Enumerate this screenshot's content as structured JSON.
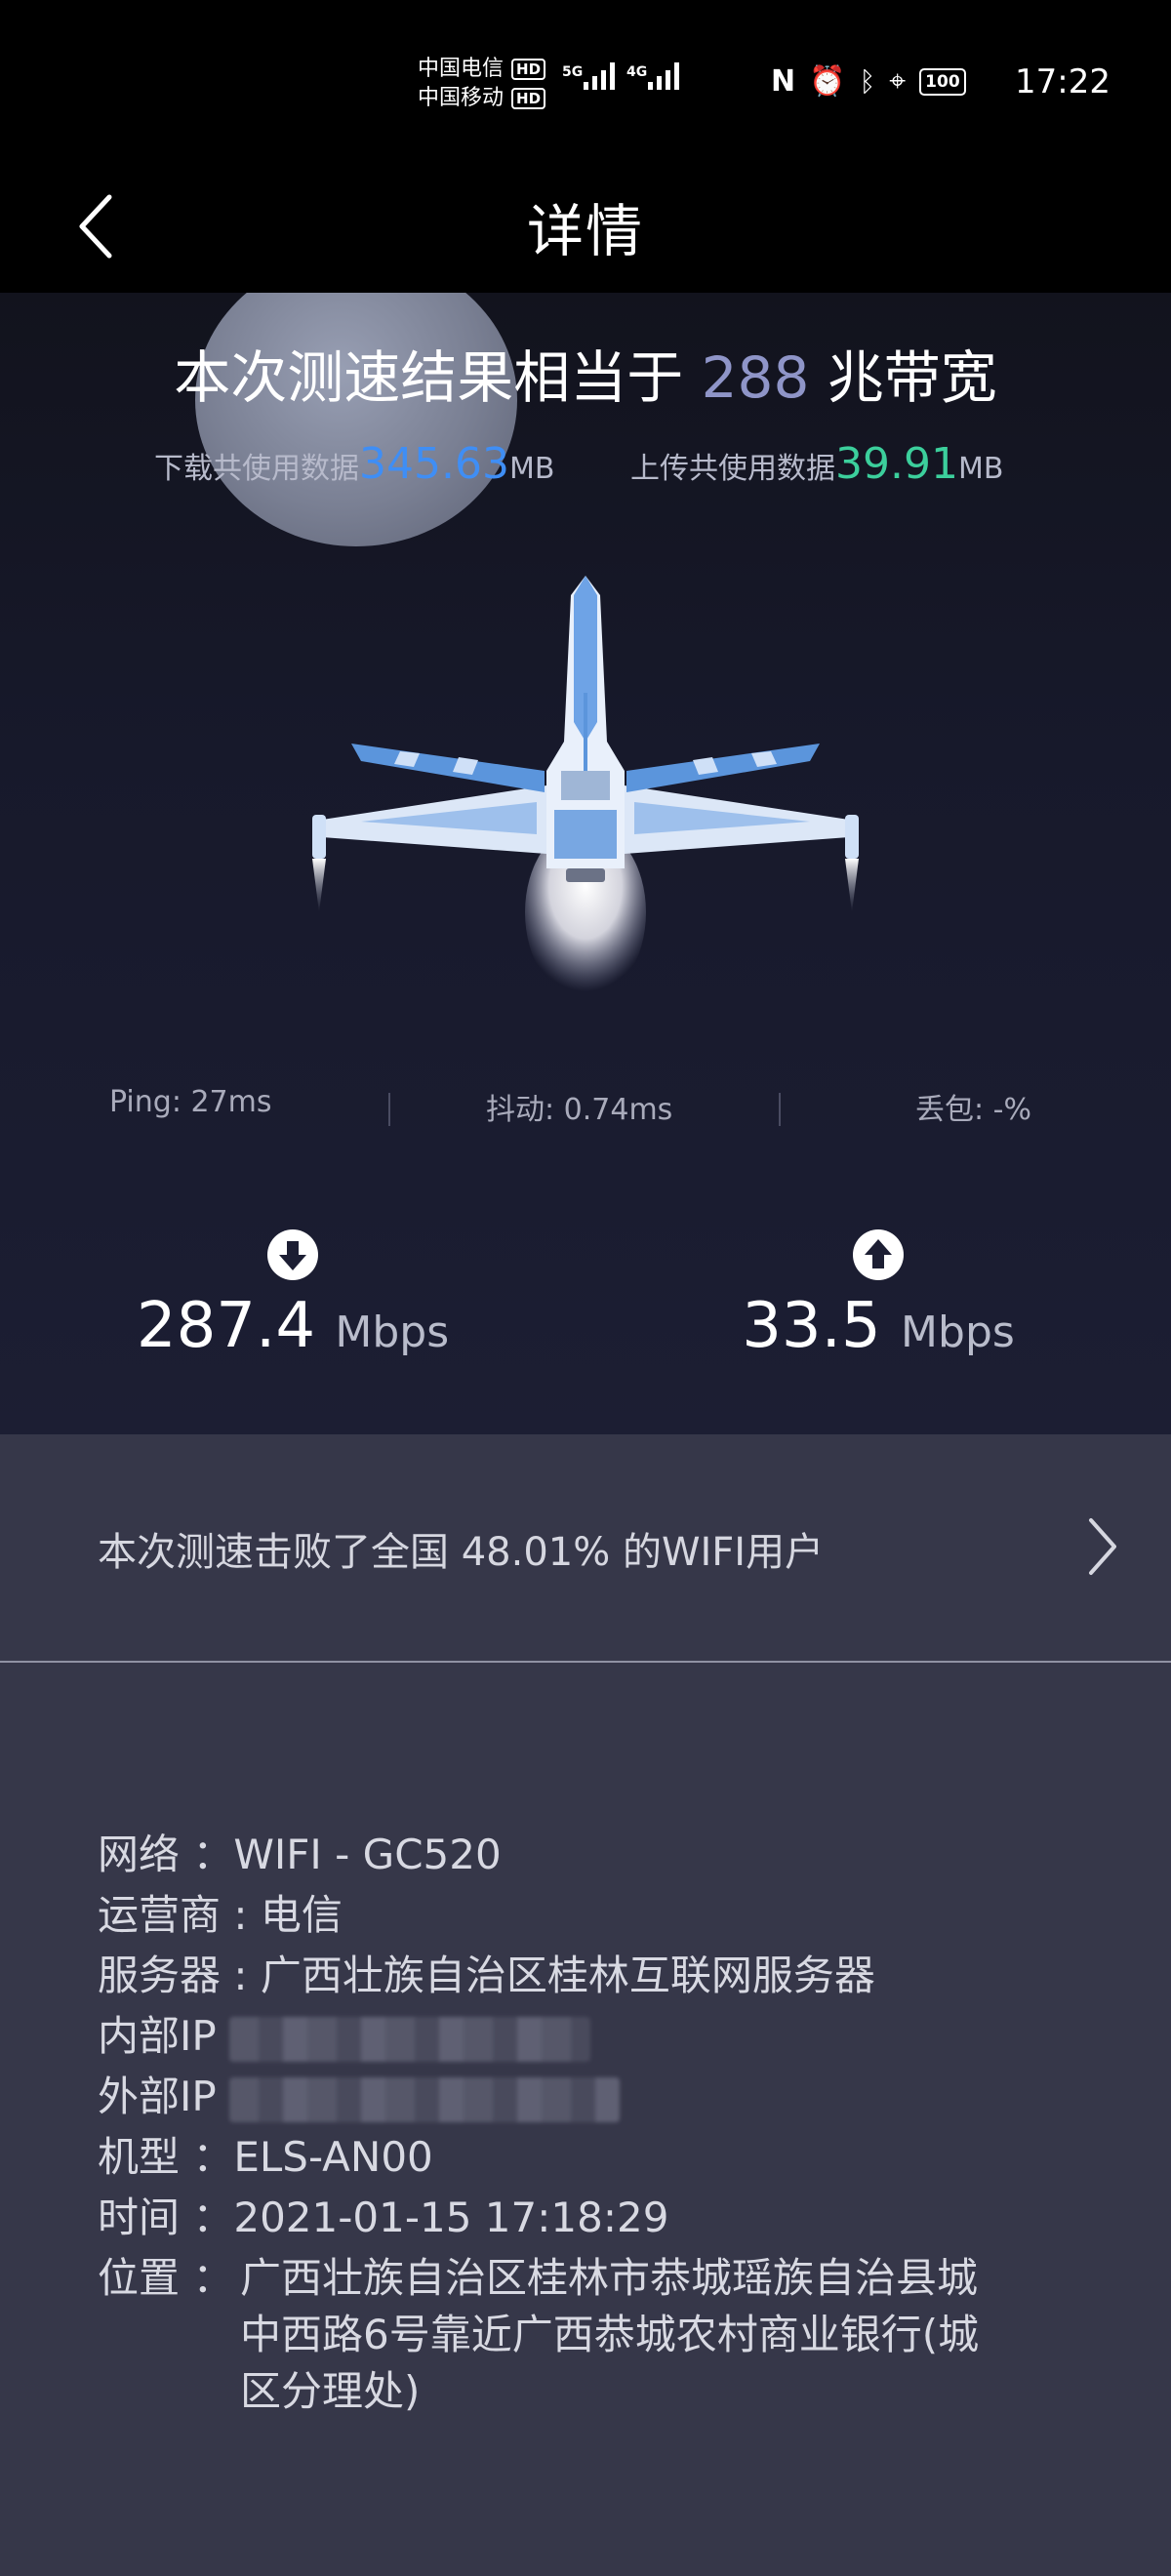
{
  "status_bar": {
    "carrier_1": "中国电信",
    "carrier_2": "中国移动",
    "hd_label": "HD",
    "sig1_tag": "5G",
    "sig2_tag": "4G",
    "battery": "100",
    "time": "17:22",
    "icons": [
      "nfc-icon",
      "alarm-icon",
      "bluetooth-icon",
      "location-icon",
      "battery-icon"
    ]
  },
  "nav": {
    "title": "详情",
    "back_icon": "back-chevron-icon"
  },
  "result": {
    "prefix": "本次测速结果相当于",
    "bandwidth": "288",
    "suffix": "兆带宽",
    "download_label": "下载共使用数据",
    "download_value": "345.63",
    "download_unit": "MB",
    "upload_label": "上传共使用数据",
    "upload_value": "39.91",
    "upload_unit": "MB"
  },
  "speeds": {
    "download_value": "287.4",
    "download_unit": "Mbps",
    "upload_value": "33.5",
    "upload_unit": "Mbps"
  },
  "stats": {
    "ping": "Ping:  27ms",
    "jitter": "抖动:  0.74ms",
    "loss": "丢包:  -%"
  },
  "beat": {
    "text": "本次测速击败了全国 48.01% 的WIFI用户"
  },
  "details": {
    "network": "网络 ：WIFI - GC520",
    "carrier": "运营商 : 电信",
    "server": "服务器 : 广西壮族自治区桂林互联网服务器",
    "internal_ip_label": "内部IP",
    "external_ip_label": "外部IP",
    "model": "机型 ：ELS-AN00",
    "time": "时间 ：2021-01-15 17:18:29",
    "location_label": "位置 ：",
    "location_line1": "广西壮族自治区桂林市恭城瑶族自治县城",
    "location_line2": "中西路6号靠近广西恭城农村商业银行(城",
    "location_line3": "区分理处)"
  },
  "colors": {
    "accent_blue": "#3f8ef5",
    "accent_green": "#3ccf9c",
    "bandwidth_purple": "#8f95c8",
    "panel": "#363749"
  }
}
